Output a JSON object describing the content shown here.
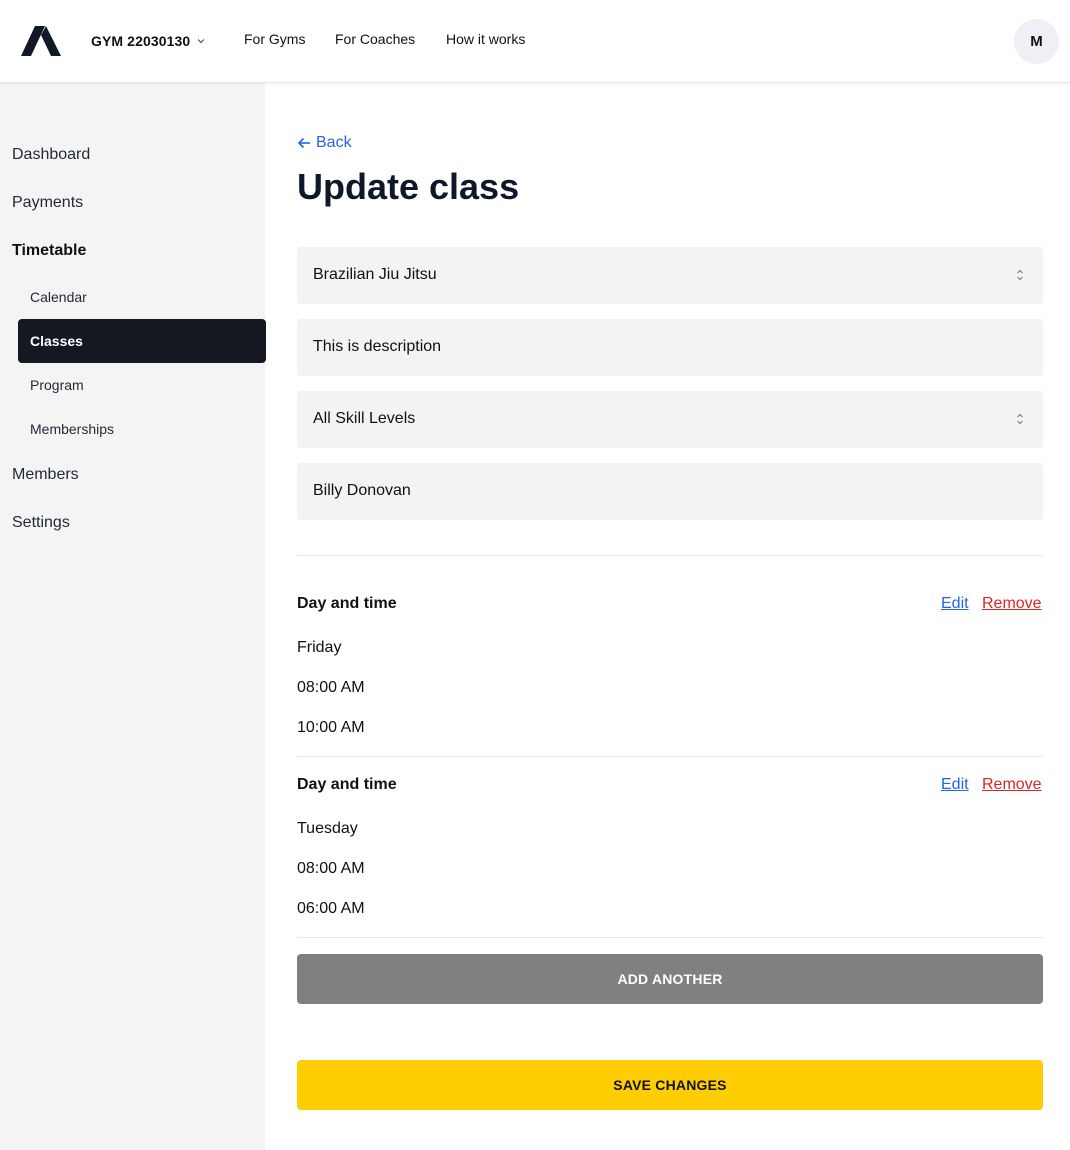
{
  "header": {
    "gym_name": "GYM 22030130",
    "nav": [
      "For Gyms",
      "For Coaches",
      "How it works"
    ],
    "avatar_initial": "M"
  },
  "sidebar": {
    "items": [
      {
        "label": "Dashboard"
      },
      {
        "label": "Payments"
      },
      {
        "label": "Timetable"
      },
      {
        "label": "Calendar"
      },
      {
        "label": "Classes"
      },
      {
        "label": "Program"
      },
      {
        "label": "Memberships"
      },
      {
        "label": "Members"
      },
      {
        "label": "Settings"
      }
    ]
  },
  "main": {
    "back_label": "Back",
    "title": "Update class",
    "fields": {
      "class_type": "Brazilian Jiu Jitsu",
      "description": "This is description",
      "skill_level": "All Skill Levels",
      "coach": "Billy Donovan"
    },
    "schedule": [
      {
        "title": "Day and time",
        "day": "Friday",
        "start": "08:00 AM",
        "end": "10:00 AM",
        "edit": "Edit",
        "remove": "Remove"
      },
      {
        "title": "Day and time",
        "day": "Tuesday",
        "start": "08:00 AM",
        "end": "06:00 AM",
        "edit": "Edit",
        "remove": "Remove"
      }
    ],
    "add_another_label": "ADD ANOTHER",
    "save_label": "SAVE CHANGES"
  },
  "colors": {
    "accent_blue": "#2563eb",
    "danger_red": "#dc2626",
    "save_yellow": "#fecd02",
    "active_nav": "#141820"
  }
}
